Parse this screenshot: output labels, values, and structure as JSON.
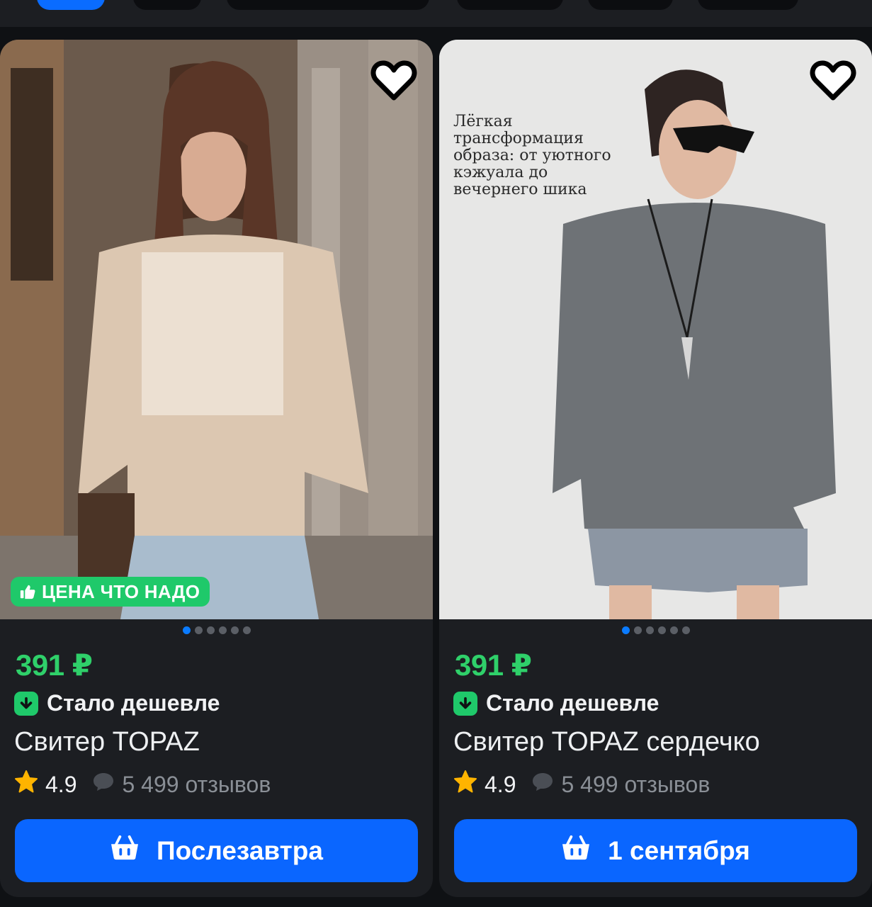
{
  "cards": [
    {
      "promo_badge": "ЦЕНА ЧТО НАДО",
      "overlay_text": "",
      "price": "391 ₽",
      "discount_label": "Стало дешевле",
      "title": "Свитер TOPAZ",
      "rating": "4.9",
      "reviews": "5 499 отзывов",
      "button_label": "Послезавтра",
      "photo_count": 6,
      "active_photo": 0
    },
    {
      "promo_badge": "",
      "overlay_text": "Лёгкая\nтрансформация\nобраза: от уютного\nкэжуала до\nвечернего шика",
      "price": "391 ₽",
      "discount_label": "Стало дешевле",
      "title": "Свитер TOPAZ сердечко",
      "rating": "4.9",
      "reviews": "5 499 отзывов",
      "button_label": "1 сентября",
      "photo_count": 6,
      "active_photo": 0
    }
  ],
  "icons": {
    "favorite": "heart-outline-icon",
    "badge": "thumbs-up-icon",
    "discount": "arrow-down-icon",
    "rating": "star-icon",
    "reviews": "speech-bubble-icon",
    "button": "basket-icon"
  },
  "colors": {
    "accent": "#0a66ff",
    "price": "#2fd06a",
    "badge": "#1fc96a",
    "star": "#ffb400",
    "card_bg": "#1c1e22",
    "page_bg": "#0f1114"
  }
}
